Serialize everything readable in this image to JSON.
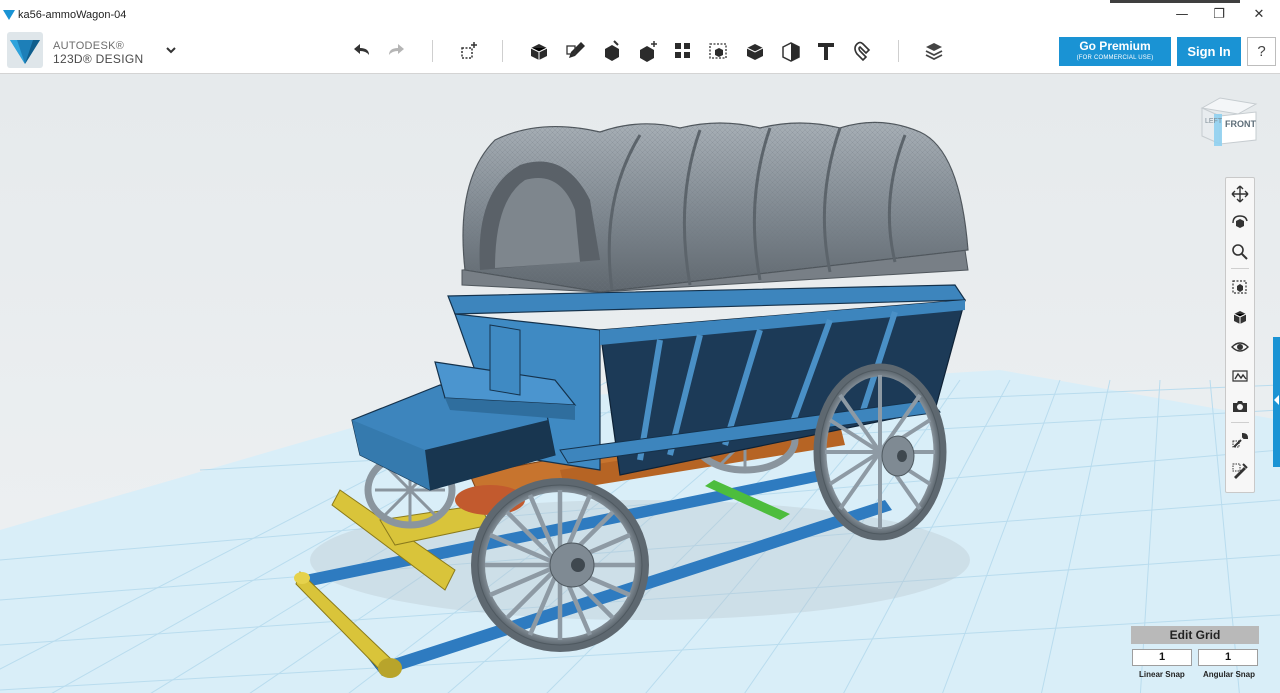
{
  "window": {
    "title": "ka56-ammoWagon-04",
    "minimize_glyph": "—",
    "restore_glyph": "❐",
    "close_glyph": "✕"
  },
  "brand": {
    "line1": "AUTODESK®",
    "line2": "123D® DESIGN",
    "logo_icon": "autodesk-123d-logo-icon",
    "menu_caret_icon": "chevron-down-icon"
  },
  "toolbar": {
    "tools": [
      {
        "name": "undo",
        "icon": "undo-arrow-icon"
      },
      {
        "name": "redo",
        "icon": "redo-arrow-icon"
      },
      {
        "name": "transform",
        "icon": "transform-box-plus-icon"
      },
      {
        "name": "primitives",
        "icon": "primitive-box-icon"
      },
      {
        "name": "sketch",
        "icon": "sketch-pencil-icon"
      },
      {
        "name": "construct",
        "icon": "construct-box-icon"
      },
      {
        "name": "modify",
        "icon": "modify-box-plus-icon"
      },
      {
        "name": "pattern",
        "icon": "pattern-grid-icon"
      },
      {
        "name": "group",
        "icon": "group-box-icon"
      },
      {
        "name": "combine",
        "icon": "combine-boxes-icon"
      },
      {
        "name": "measure",
        "icon": "measure-box-icon"
      },
      {
        "name": "text",
        "icon": "text-t-icon"
      },
      {
        "name": "snap",
        "icon": "snap-magnet-icon"
      },
      {
        "name": "material",
        "icon": "material-stack-icon"
      }
    ],
    "premium": {
      "label": "Go Premium",
      "sublabel": "(FOR COMMERCIAL USE)"
    },
    "signin_label": "Sign In",
    "help_label": "?"
  },
  "viewcube": {
    "left_label": "LEFT",
    "front_label": "FRONT"
  },
  "navbar": {
    "items": [
      {
        "name": "pan",
        "icon": "pan-arrows-icon"
      },
      {
        "name": "orbit",
        "icon": "orbit-icon"
      },
      {
        "name": "zoom",
        "icon": "zoom-magnifier-icon"
      },
      {
        "name": "fit",
        "icon": "fit-view-icon"
      },
      {
        "name": "perspective",
        "icon": "view-box-icon"
      },
      {
        "name": "visibility",
        "icon": "eye-icon"
      },
      {
        "name": "material-display",
        "icon": "material-display-icon"
      },
      {
        "name": "screenshot",
        "icon": "camera-icon"
      },
      {
        "name": "tools-a",
        "icon": "wrench-icon"
      },
      {
        "name": "tools-b",
        "icon": "brush-icon"
      }
    ]
  },
  "edit_grid": {
    "title": "Edit Grid",
    "linear_value": "1",
    "angular_value": "1",
    "linear_label": "Linear Snap",
    "angular_label": "Angular Snap"
  },
  "colors": {
    "accent": "#1a93d4",
    "grid_floor": "#d7ecf6",
    "wagon_body": "#3d85bd",
    "wagon_dark": "#1a3550",
    "canopy": "#7e8690",
    "wheel": "#8e9aa4",
    "axle_orange": "#c7742e",
    "tongue_yellow": "#d9c43a",
    "chassis_blue": "#2e7bc0",
    "brace_green": "#4dbd3d"
  }
}
